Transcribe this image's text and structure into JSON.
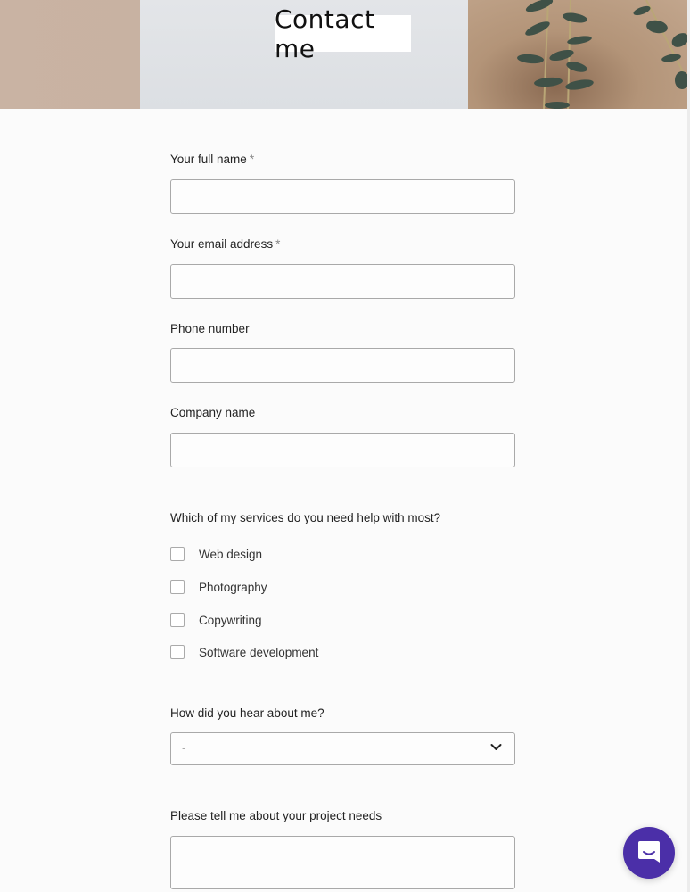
{
  "header": {
    "title": "Contact me"
  },
  "form": {
    "fields": [
      {
        "label": "Your full name",
        "required_mark": "*",
        "value": "",
        "placeholder": ""
      },
      {
        "label": "Your email address",
        "required_mark": "*",
        "value": "",
        "placeholder": ""
      },
      {
        "label": "Phone number",
        "required_mark": "",
        "value": "",
        "placeholder": ""
      },
      {
        "label": "Company name",
        "required_mark": "",
        "value": "",
        "placeholder": ""
      }
    ],
    "services": {
      "question": "Which of my services do you need help with most?",
      "options": [
        {
          "label": "Web design",
          "checked": false
        },
        {
          "label": "Photography",
          "checked": false
        },
        {
          "label": "Copywriting",
          "checked": false
        },
        {
          "label": "Software development",
          "checked": false
        }
      ]
    },
    "referral": {
      "question": "How did you hear about me?",
      "selected": "-"
    },
    "project": {
      "question": "Please tell me about your project needs",
      "value": ""
    }
  },
  "chat": {
    "icon": "chat-bubble-icon",
    "color": "#4b2fa8"
  }
}
